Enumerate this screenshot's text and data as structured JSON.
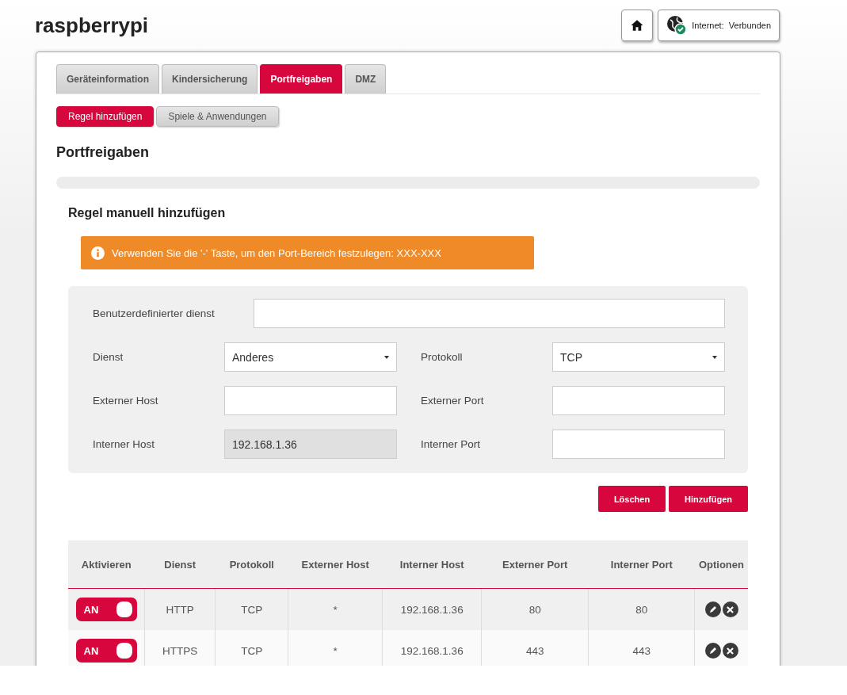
{
  "header": {
    "title": "raspberrypi",
    "status_label": "Internet:",
    "status_value": "Verbunden"
  },
  "tabs": [
    {
      "label": "Geräteinformation",
      "selected": false
    },
    {
      "label": "Kindersicherung",
      "selected": false
    },
    {
      "label": "Portfreigaben",
      "selected": true
    },
    {
      "label": "DMZ",
      "selected": false
    }
  ],
  "subtabs": [
    {
      "label": "Regel hinzufügen",
      "selected": true
    },
    {
      "label": "Spiele & Anwendungen",
      "selected": false
    }
  ],
  "page_title": "Portfreigaben",
  "section_title": "Regel manuell hinzufügen",
  "alert": "Verwenden Sie die '-' Taste, um den Port-Bereich festzulegen: XXX-XXX",
  "form": {
    "custom_service": {
      "label": "Benutzerdefinierter dienst"
    },
    "fields": [
      {
        "label": "Dienst",
        "kind": "select",
        "value": "Anderes"
      },
      {
        "label": "Protokoll",
        "kind": "select",
        "value": "TCP"
      },
      {
        "label": "Externer Host",
        "kind": "input",
        "disabled": false
      },
      {
        "label": "Externer Port",
        "kind": "input",
        "disabled": false
      },
      {
        "label": "Interner Host",
        "kind": "input",
        "value": "192.168.1.36",
        "disabled": true
      },
      {
        "label": "Interner Port",
        "kind": "input",
        "disabled": false
      }
    ]
  },
  "buttons": [
    "Löschen",
    "Hinzufügen"
  ],
  "table": {
    "columns": [
      "Aktivieren",
      "Dienst",
      "Protokoll",
      "Externer Host",
      "Interner Host",
      "Externer Port",
      "Interner Port",
      "Optionen"
    ],
    "rows": [
      {
        "on": true,
        "cells": [
          "AN",
          "HTTP",
          "TCP",
          "*",
          "192.168.1.36",
          "80",
          "80"
        ]
      },
      {
        "on": true,
        "cells": [
          "AN",
          "HTTPS",
          "TCP",
          "*",
          "192.168.1.36",
          "443",
          "443"
        ]
      }
    ]
  }
}
